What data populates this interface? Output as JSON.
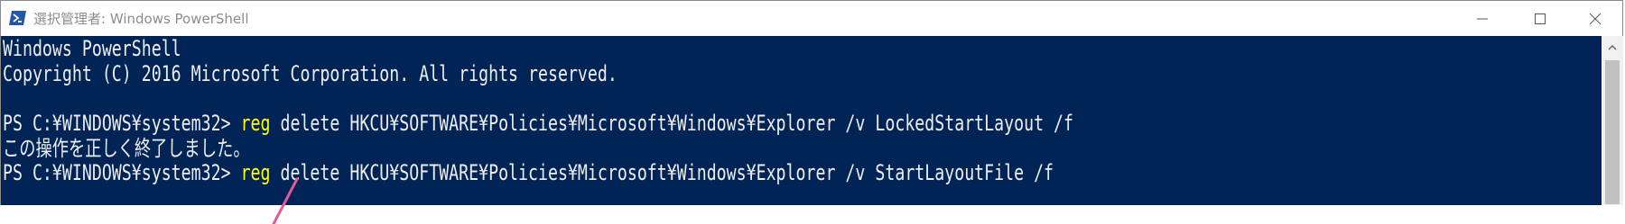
{
  "window": {
    "title": "選択管理者: Windows PowerShell",
    "icon": "powershell-icon"
  },
  "caption_buttons": {
    "minimize": "minimize-icon",
    "maximize": "maximize-icon",
    "close": "close-icon"
  },
  "console": {
    "background": "#012456",
    "text_color": "#eeedf0",
    "command_color": "#ffff00",
    "lines": [
      {
        "text": "Windows PowerShell"
      },
      {
        "text": "Copyright (C) 2016 Microsoft Corporation. All rights reserved."
      },
      {
        "text": ""
      },
      {
        "prompt": "PS C:¥WINDOWS¥system32> ",
        "command": "reg",
        "args": " delete HKCU¥SOFTWARE¥Policies¥Microsoft¥Windows¥Explorer /v LockedStartLayout /f"
      },
      {
        "text": "この操作を正しく終了しました。"
      },
      {
        "prompt": "PS C:¥WINDOWS¥system32> ",
        "command": "reg",
        "args": " delete HKCU¥SOFTWARE¥Policies¥Microsoft¥Windows¥Explorer /v StartLayoutFile /f"
      }
    ]
  },
  "annotation": {
    "color": "#e05a9c"
  }
}
